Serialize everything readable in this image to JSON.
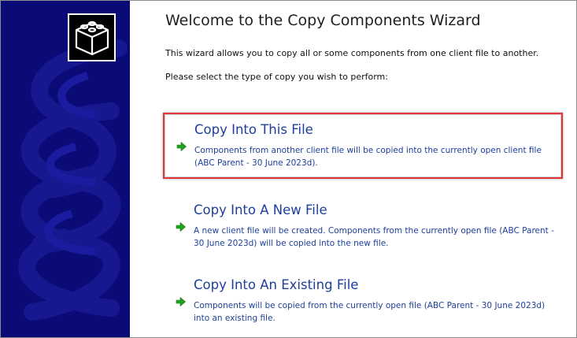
{
  "wizard": {
    "title": "Welcome to the Copy Components Wizard",
    "intro_line1": "This wizard allows you to copy all or some components from one client file to another.",
    "intro_line2": "Please select the type of copy you wish to perform:"
  },
  "options": [
    {
      "title": "Copy Into This File",
      "desc_line1": "Components from another client file will be copied into the currently open client file",
      "desc_line2": "(ABC Parent - 30 June 2023d).",
      "selected": true
    },
    {
      "title": "Copy Into A New File",
      "desc_line1": "A new client file will be created. Components from the currently open file (ABC Parent -",
      "desc_line2": "30 June 2023d) will be copied into the new file.",
      "selected": false
    },
    {
      "title": "Copy Into An Existing File",
      "desc_line1": "Components will be copied from the currently open file (ABC Parent - 30 June 2023d)",
      "desc_line2": "into an existing file.",
      "selected": false
    }
  ],
  "icons": {
    "logo": "cube-logo-icon",
    "option_arrow": "green-arrow-icon"
  },
  "colors": {
    "sidebar": "#0b0b78",
    "accent_text": "#1d3f9a",
    "selection_border": "#e0343a",
    "arrow": "#1fa31f"
  }
}
